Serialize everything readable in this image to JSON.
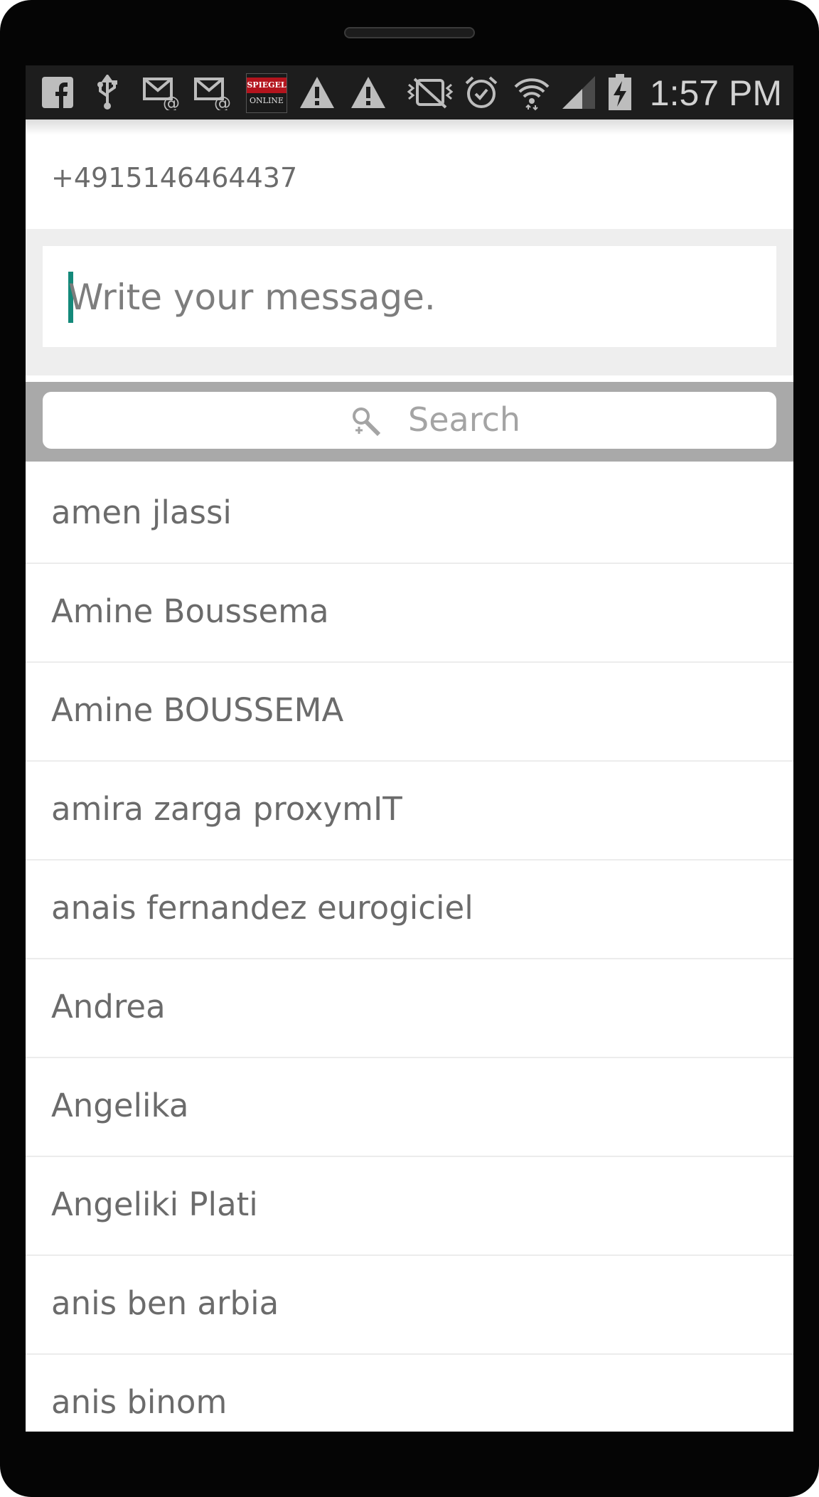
{
  "status_bar": {
    "time": "1:57 PM",
    "icons": [
      "facebook-icon",
      "usb-icon",
      "email-icon",
      "email-icon",
      "spiegel-online-icon",
      "warning-icon",
      "warning-icon",
      "vibrate-mute-icon",
      "alarm-icon",
      "wifi-icon",
      "signal-icon",
      "battery-charging-icon"
    ],
    "spiegel_line1": "SPIEGEL",
    "spiegel_line2": "ONLINE"
  },
  "recipient": {
    "number": "+4915146464437"
  },
  "compose": {
    "placeholder": "Write your message."
  },
  "search": {
    "label": "Search"
  },
  "contacts": [
    "amen jlassi",
    "Amine Boussema",
    "Amine BOUSSEMA",
    "amira zarga proxymIT",
    "anais fernandez eurogiciel",
    "Andrea",
    "Angelika",
    "Angeliki Plati",
    "anis ben arbia",
    "anis binom"
  ],
  "colors": {
    "accent": "#14897a",
    "status_bar": "#1d1d1d",
    "search_band": "#a9a9a9",
    "compose_band": "#eeeeee"
  }
}
